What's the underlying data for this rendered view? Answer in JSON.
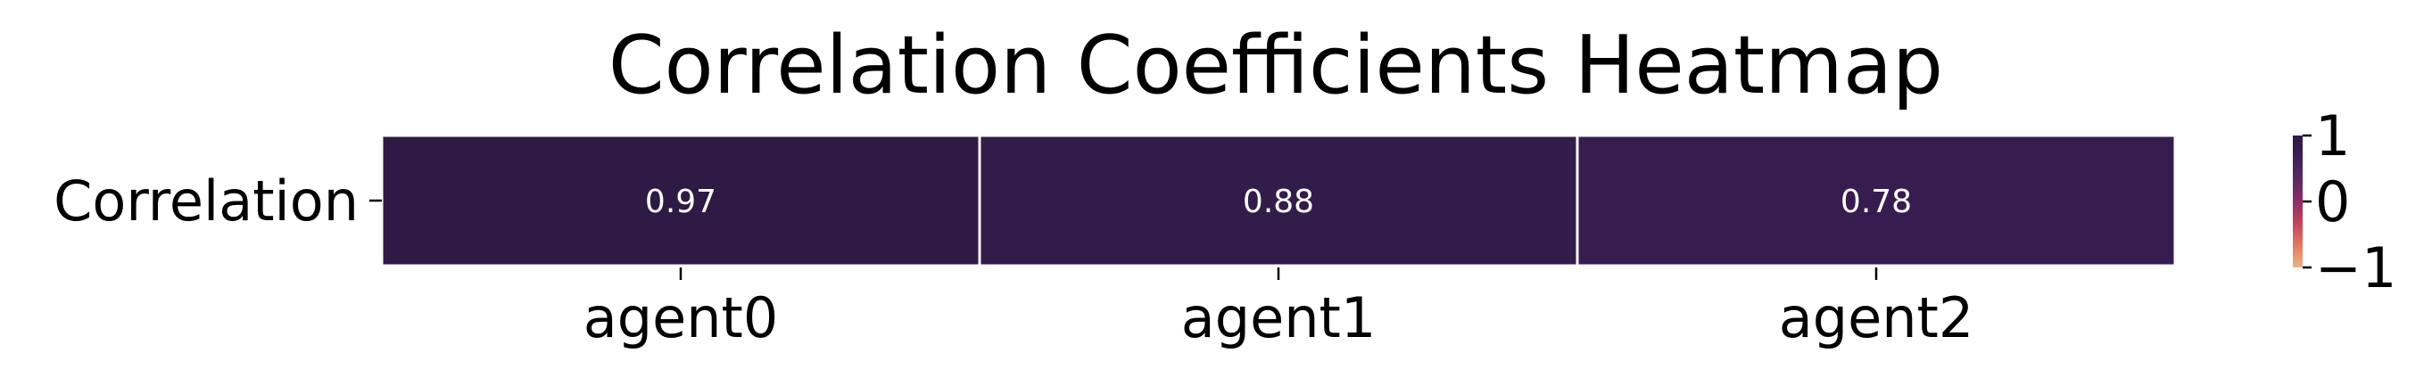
{
  "chart_data": {
    "type": "heatmap",
    "title": "Correlation Coefficients Heatmap",
    "row_labels": [
      "Correlation"
    ],
    "column_labels": [
      "agent0",
      "agent1",
      "agent2"
    ],
    "values": [
      [
        0.97,
        0.88,
        0.78
      ]
    ],
    "cell_labels": [
      [
        "0.97",
        "0.88",
        "0.78"
      ]
    ],
    "color_scale": {
      "min": -1,
      "max": 1,
      "ticks": [
        1,
        0,
        -1
      ],
      "tick_labels": [
        "1",
        "0",
        "−1"
      ],
      "colors": [
        "#e8b48a",
        "#e17b61",
        "#c2455b",
        "#8e2d67",
        "#5e2963",
        "#3d1f55",
        "#2c1a42"
      ]
    },
    "cell_border_color": "#ffffff",
    "cell_label_color": "#ffffff",
    "colorbar_position": "right"
  }
}
